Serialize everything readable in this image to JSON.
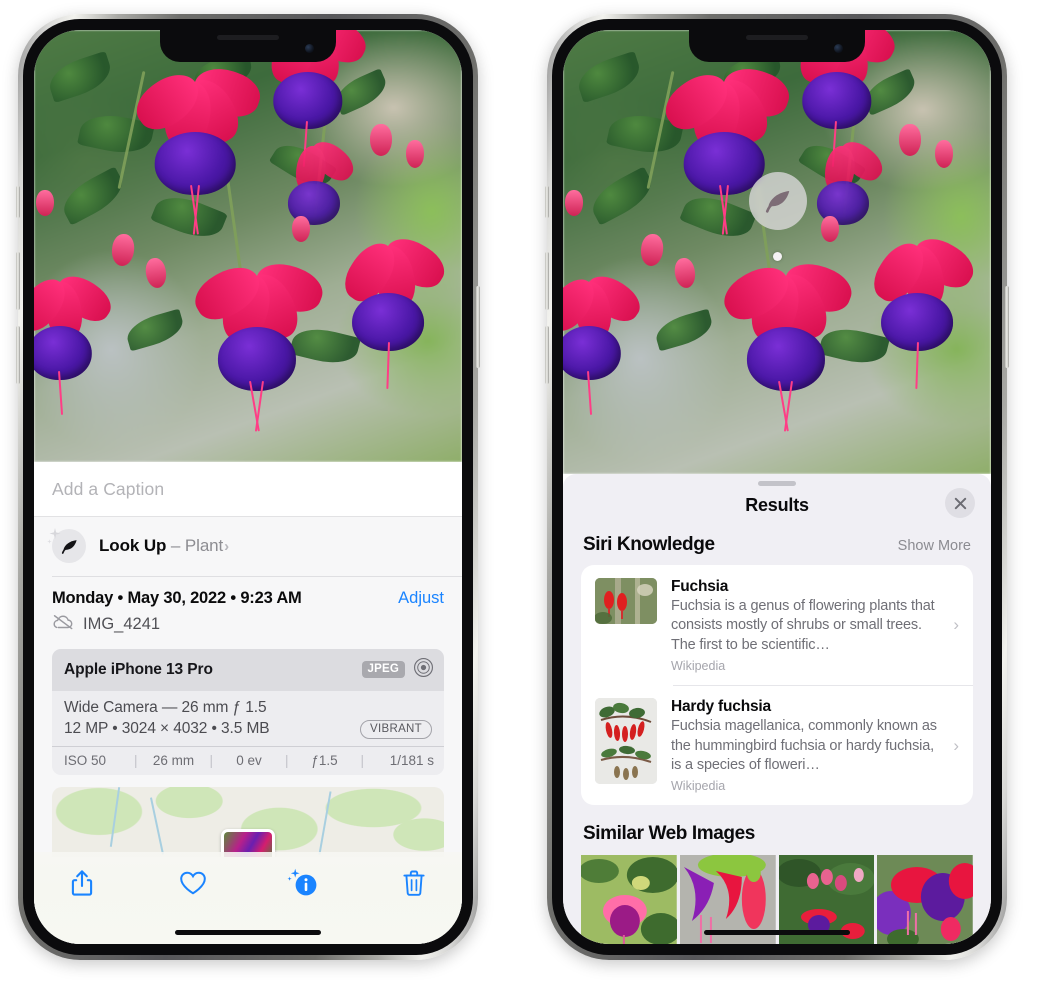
{
  "left_phone": {
    "name": "iPhone showing Photos info panel",
    "photo": {
      "alt": "Fuchsia flowers hanging basket"
    },
    "caption": {
      "placeholder": "Add a Caption",
      "value": ""
    },
    "look_up": {
      "icon": "leaf-icon",
      "sparkle_icon": "sparkles-icon",
      "label": "Look Up",
      "dash": " – ",
      "subject": "Plant",
      "chevron": "›"
    },
    "date_row": {
      "date": "Monday • May 30, 2022 • 9:23 AM",
      "adjust_label": "Adjust"
    },
    "file_row": {
      "icon": "cloud-slash-icon",
      "filename": "IMG_4241"
    },
    "exif": {
      "device": "Apple iPhone 13 Pro",
      "format_chip": "JPEG",
      "aperture_icon": "aperture-icon",
      "lens": "Wide Camera — 26 mm ƒ 1.5",
      "details": "12 MP  •  3024 × 4032  •  3.5 MB",
      "style_chip": "VIBRANT",
      "settings": [
        "ISO 50",
        "26 mm",
        "0 ev",
        "ƒ1.5",
        "1/181 s"
      ],
      "separator": "|"
    },
    "map": {
      "alt": "Map of photo location",
      "pin": "photo-thumbnail-pin"
    },
    "toolbar": [
      {
        "name": "share-button",
        "icon": "share-icon"
      },
      {
        "name": "favorite-button",
        "icon": "heart-icon"
      },
      {
        "name": "info-button",
        "icon": "info-sparkle-icon"
      },
      {
        "name": "delete-button",
        "icon": "trash-icon"
      }
    ],
    "accent_color": "#1a84ff"
  },
  "right_phone": {
    "name": "iPhone showing Visual Look Up results",
    "visual_lookup_badge": {
      "icon": "leaf-icon",
      "label": "Visual Look Up"
    },
    "sheet": {
      "grabber": "sheet-grabber",
      "title": "Results",
      "close_icon": "close-icon"
    },
    "siri_knowledge": {
      "title": "Siri Knowledge",
      "show_more": "Show More",
      "items": [
        {
          "title": "Fuchsia",
          "description": "Fuchsia is a genus of flowering plants that consists mostly of shrubs or small trees. The first to be scientific…",
          "source": "Wikipedia",
          "thumb": "fuchsia-red-flowers-thumbnail",
          "chevron": "›"
        },
        {
          "title": "Hardy fuchsia",
          "description": "Fuchsia magellanica, commonly known as the hummingbird fuchsia or hardy fuchsia, is a species of floweri…",
          "source": "Wikipedia",
          "thumb": "hardy-fuchsia-specimen-thumbnail",
          "chevron": "›"
        }
      ]
    },
    "similar_web_images": {
      "title": "Similar Web Images",
      "items": [
        {
          "alt": "pink and magenta fuchsia with green leaves"
        },
        {
          "alt": "close-up red and magenta fuchsia blooms"
        },
        {
          "alt": "fuchsia bush with buds and red flowers"
        },
        {
          "alt": "purple and red double fuchsia flowers"
        }
      ]
    }
  }
}
